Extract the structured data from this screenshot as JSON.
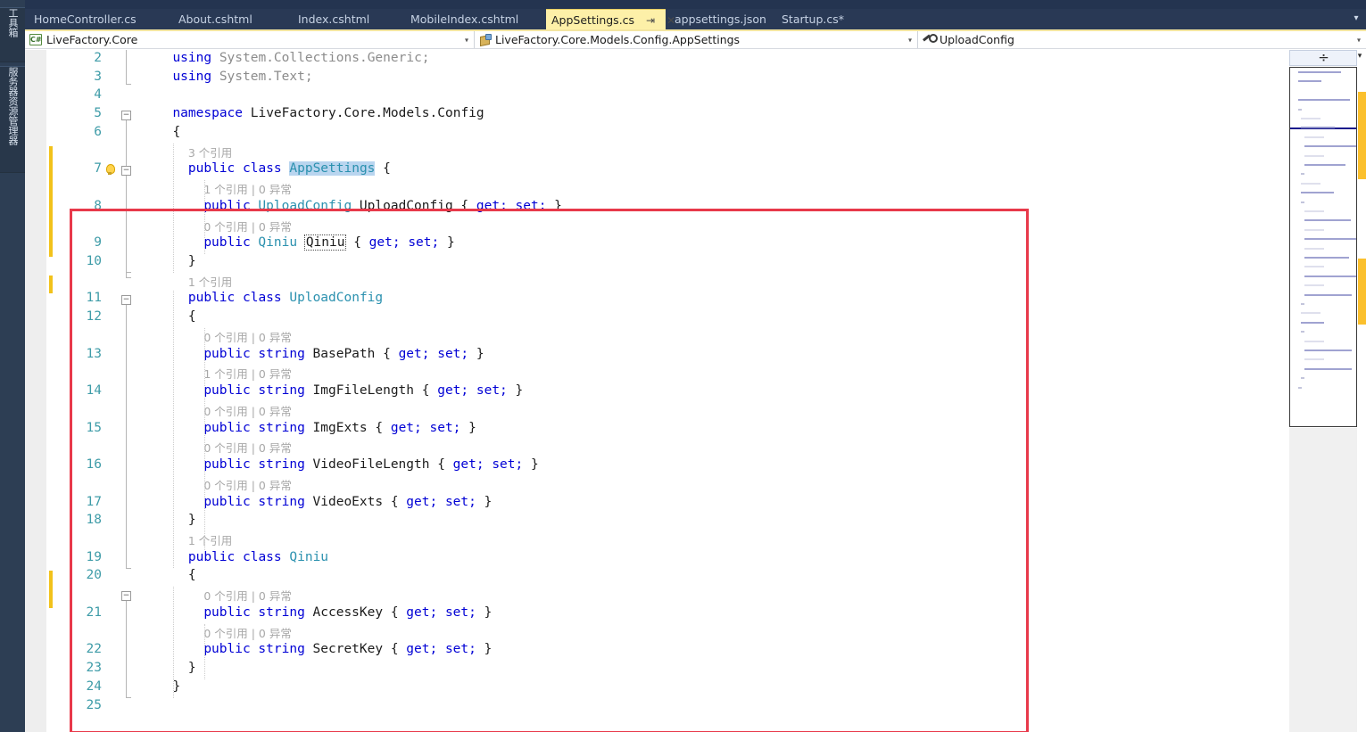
{
  "left_dock": {
    "items": [
      {
        "label": "工具箱",
        "name": "toolbox"
      },
      {
        "label": "服务器资源管理器",
        "name": "server-explorer"
      }
    ]
  },
  "tabs": {
    "items": [
      {
        "label": "HomeController.cs",
        "active": false
      },
      {
        "label": "About.cshtml",
        "active": false
      },
      {
        "label": "Index.cshtml",
        "active": false
      },
      {
        "label": "MobileIndex.cshtml",
        "active": false
      },
      {
        "label": "AppSettings.cs",
        "active": true,
        "pin": "⇥",
        "close": "✕"
      },
      {
        "label": "appsettings.json",
        "active": false
      },
      {
        "label": "Startup.cs*",
        "active": false
      }
    ],
    "overflow_glyph": "▾"
  },
  "navbar": {
    "project": "LiveFactory.Core",
    "project_icon": "csharp-file-icon",
    "type": "LiveFactory.Core.Models.Config.AppSettings",
    "type_icon": "class-icon",
    "member": "UploadConfig",
    "member_icon": "property-icon",
    "arrow_glyph": "▾"
  },
  "editor": {
    "font_size": "14.5px",
    "lines": [
      {
        "num": "2",
        "indent": 2,
        "tokens": [
          {
            "t": "using",
            "c": "kw"
          },
          {
            "t": " System.Collections.Generic;",
            "c": "cmt"
          }
        ]
      },
      {
        "num": "3",
        "indent": 2,
        "tokens": [
          {
            "t": "using",
            "c": "kw"
          },
          {
            "t": " System.Text;",
            "c": "cmt"
          }
        ]
      },
      {
        "num": "4",
        "indent": 2,
        "tokens": []
      },
      {
        "num": "5",
        "indent": 2,
        "tokens": [
          {
            "t": "namespace",
            "c": "kw"
          },
          {
            "t": " LiveFactory.Core.Models.Config",
            "c": "id"
          }
        ]
      },
      {
        "num": "6",
        "indent": 2,
        "tokens": [
          {
            "t": "{",
            "c": "pun"
          }
        ]
      },
      {
        "num": "",
        "indent": 4,
        "lens": "3 个引用"
      },
      {
        "num": "7",
        "indent": 4,
        "tokens": [
          {
            "t": "public class ",
            "c": "kw"
          },
          {
            "t": "AppSettings",
            "c": "typ sel"
          },
          {
            "t": " {",
            "c": "pun"
          }
        ]
      },
      {
        "num": "",
        "indent": 6,
        "lens": "1 个引用 | 0 异常"
      },
      {
        "num": "8",
        "indent": 6,
        "tokens": [
          {
            "t": "public ",
            "c": "kw"
          },
          {
            "t": "UploadConfig",
            "c": "typ"
          },
          {
            "t": " UploadConfig { ",
            "c": "id"
          },
          {
            "t": "get; set;",
            "c": "kw"
          },
          {
            "t": " }",
            "c": "pun"
          }
        ]
      },
      {
        "num": "",
        "indent": 6,
        "lens": "0 个引用 | 0 异常"
      },
      {
        "num": "9",
        "indent": 6,
        "tokens": [
          {
            "t": "public ",
            "c": "kw"
          },
          {
            "t": "Qiniu",
            "c": "typ"
          },
          {
            "t": " ",
            "c": "id"
          },
          {
            "t": "Qiniu",
            "c": "id dotref"
          },
          {
            "t": " { ",
            "c": "id"
          },
          {
            "t": "get; set;",
            "c": "kw"
          },
          {
            "t": " }",
            "c": "pun"
          }
        ]
      },
      {
        "num": "10",
        "indent": 4,
        "tokens": [
          {
            "t": "}",
            "c": "pun"
          }
        ]
      },
      {
        "num": "",
        "indent": 4,
        "lens": "1 个引用"
      },
      {
        "num": "11",
        "indent": 4,
        "tokens": [
          {
            "t": "public class ",
            "c": "kw"
          },
          {
            "t": "UploadConfig",
            "c": "typ"
          }
        ]
      },
      {
        "num": "12",
        "indent": 4,
        "tokens": [
          {
            "t": "{",
            "c": "pun"
          }
        ]
      },
      {
        "num": "",
        "indent": 6,
        "lens": "0 个引用 | 0 异常"
      },
      {
        "num": "13",
        "indent": 6,
        "tokens": [
          {
            "t": "public string ",
            "c": "kw"
          },
          {
            "t": "BasePath { ",
            "c": "id"
          },
          {
            "t": "get; set;",
            "c": "kw"
          },
          {
            "t": " }",
            "c": "pun"
          }
        ]
      },
      {
        "num": "",
        "indent": 6,
        "lens": "1 个引用 | 0 异常"
      },
      {
        "num": "14",
        "indent": 6,
        "tokens": [
          {
            "t": "public string ",
            "c": "kw"
          },
          {
            "t": "ImgFileLength { ",
            "c": "id"
          },
          {
            "t": "get; set;",
            "c": "kw"
          },
          {
            "t": " }",
            "c": "pun"
          }
        ]
      },
      {
        "num": "",
        "indent": 6,
        "lens": "0 个引用 | 0 异常"
      },
      {
        "num": "15",
        "indent": 6,
        "tokens": [
          {
            "t": "public string ",
            "c": "kw"
          },
          {
            "t": "ImgExts { ",
            "c": "id"
          },
          {
            "t": "get; set;",
            "c": "kw"
          },
          {
            "t": " }",
            "c": "pun"
          }
        ]
      },
      {
        "num": "",
        "indent": 6,
        "lens": "0 个引用 | 0 异常"
      },
      {
        "num": "16",
        "indent": 6,
        "tokens": [
          {
            "t": "public string ",
            "c": "kw"
          },
          {
            "t": "VideoFileLength { ",
            "c": "id"
          },
          {
            "t": "get; set;",
            "c": "kw"
          },
          {
            "t": " }",
            "c": "pun"
          }
        ]
      },
      {
        "num": "",
        "indent": 6,
        "lens": "0 个引用 | 0 异常"
      },
      {
        "num": "17",
        "indent": 6,
        "tokens": [
          {
            "t": "public string ",
            "c": "kw"
          },
          {
            "t": "VideoExts { ",
            "c": "id"
          },
          {
            "t": "get; set;",
            "c": "kw"
          },
          {
            "t": " }",
            "c": "pun"
          }
        ]
      },
      {
        "num": "18",
        "indent": 4,
        "tokens": [
          {
            "t": "}",
            "c": "pun"
          }
        ]
      },
      {
        "num": "",
        "indent": 4,
        "lens": "1 个引用"
      },
      {
        "num": "19",
        "indent": 4,
        "tokens": [
          {
            "t": "public class ",
            "c": "kw"
          },
          {
            "t": "Qiniu",
            "c": "typ"
          }
        ]
      },
      {
        "num": "20",
        "indent": 4,
        "tokens": [
          {
            "t": "{",
            "c": "pun"
          }
        ]
      },
      {
        "num": "",
        "indent": 6,
        "lens": "0 个引用 | 0 异常"
      },
      {
        "num": "21",
        "indent": 6,
        "tokens": [
          {
            "t": "public string ",
            "c": "kw"
          },
          {
            "t": "AccessKey { ",
            "c": "id"
          },
          {
            "t": "get; set;",
            "c": "kw"
          },
          {
            "t": " }",
            "c": "pun"
          }
        ]
      },
      {
        "num": "",
        "indent": 6,
        "lens": "0 个引用 | 0 异常"
      },
      {
        "num": "22",
        "indent": 6,
        "tokens": [
          {
            "t": "public string ",
            "c": "kw"
          },
          {
            "t": "SecretKey { ",
            "c": "id"
          },
          {
            "t": "get; set;",
            "c": "kw"
          },
          {
            "t": " }",
            "c": "pun"
          }
        ]
      },
      {
        "num": "23",
        "indent": 4,
        "tokens": [
          {
            "t": "}",
            "c": "pun"
          }
        ]
      },
      {
        "num": "24",
        "indent": 2,
        "tokens": [
          {
            "t": "}",
            "c": "pun"
          }
        ]
      },
      {
        "num": "25",
        "indent": 2,
        "tokens": []
      }
    ]
  },
  "annotation": {
    "color": "#e8394a",
    "shape": "rectangle"
  },
  "minimap": {
    "splitter_glyph": "÷",
    "caret_glyph": "▾",
    "change_marker_color": "#fbc02d"
  },
  "colors": {
    "tab_active_bg": "#fdf0a8",
    "tabstrip_bg": "#293955",
    "keyword": "#0000d5",
    "type": "#2b91af",
    "linenumber": "#3f9ca8",
    "codelens": "#a8a8a8",
    "changebar": "#f2c21b",
    "selection": "#b9d5ef"
  }
}
